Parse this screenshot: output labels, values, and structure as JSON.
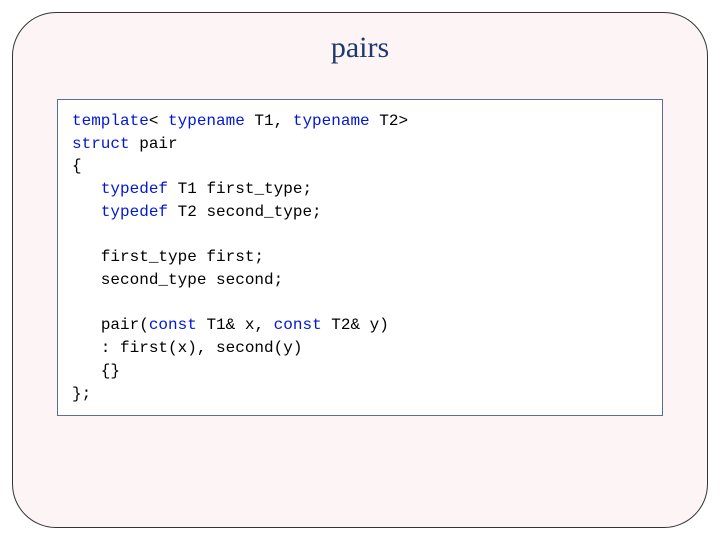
{
  "title": "pairs",
  "code": {
    "l1": {
      "k1": "template",
      "t1": "< ",
      "k2": "typename",
      "t2": " T1, ",
      "k3": "typename",
      "t3": " T2>"
    },
    "l2": {
      "k1": "struct",
      "t1": " pair"
    },
    "l3": "{",
    "l4": {
      "pad": "   ",
      "k1": "typedef",
      "t1": " T1 first_type;"
    },
    "l5": {
      "pad": "   ",
      "k1": "typedef",
      "t1": " T2 second_type;"
    },
    "l6": "",
    "l7": "   first_type first;",
    "l8": "   second_type second;",
    "l9": "",
    "l10": {
      "pad": "   ",
      "t1": "pair(",
      "k1": "const",
      "t2": " T1& x, ",
      "k2": "const",
      "t3": " T2& y)"
    },
    "l11": "   : first(x), second(y)",
    "l12": "   {}",
    "l13": "};"
  }
}
